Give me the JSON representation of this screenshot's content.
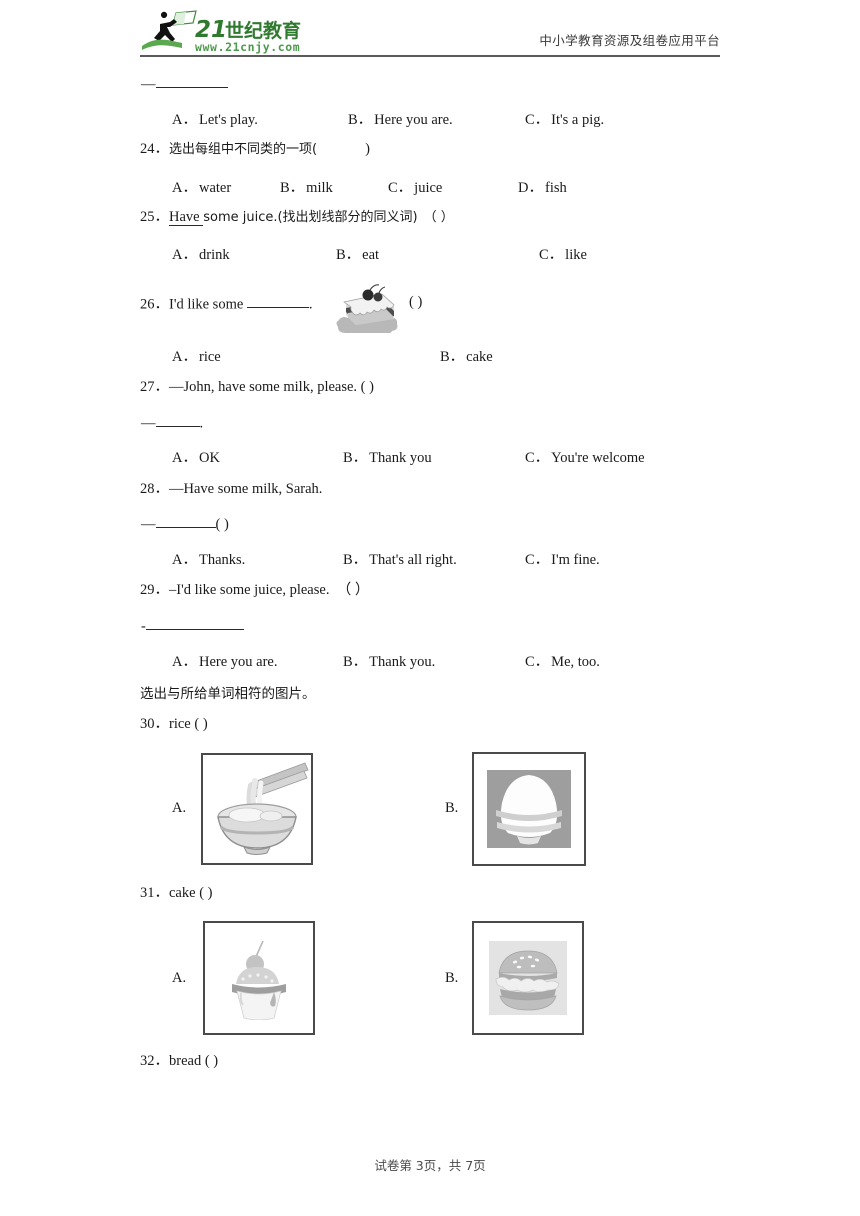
{
  "header": {
    "logo_title": "21世纪教育",
    "logo_url": "www.21cnjy.com",
    "logo_digits": "21",
    "logo_han": "世纪教育",
    "platform_text": "中小学教育资源及组卷应用平台",
    "brand_color": "#3d8b3d",
    "brand_color_dark": "#2f6b2f"
  },
  "questions": [
    {
      "id": "q23-continuation",
      "stem_dash": "—",
      "stem_blank": true,
      "options": [
        {
          "label": "A．",
          "text": "Let's play."
        },
        {
          "label": "B．",
          "text": "Here you are."
        },
        {
          "label": "C．",
          "text": "It's a pig."
        }
      ]
    },
    {
      "id": "q24",
      "number": "24．",
      "stem": "选出每组中不同类的一项(",
      "stem_tail": ")",
      "options": [
        {
          "label": "A．",
          "text": "water"
        },
        {
          "label": "B．",
          "text": "milk"
        },
        {
          "label": "C．",
          "text": "juice"
        },
        {
          "label": "D．",
          "text": "fish"
        }
      ]
    },
    {
      "id": "q25",
      "number": "25．",
      "stem_underlined": "Have",
      "stem_rest": "some juice.(找出划线部分的同义词)",
      "stem_paren": "（              ）",
      "options": [
        {
          "label": "A．",
          "text": "drink"
        },
        {
          "label": "B．",
          "text": "eat"
        },
        {
          "label": "C．",
          "text": "like"
        }
      ]
    },
    {
      "id": "q26",
      "number": "26．",
      "stem_pre": "I'd like some",
      "stem_post": ".",
      "stem_paren": "(              )",
      "image_alt": "cake-slice-illustration",
      "options": [
        {
          "label": "A．",
          "text": "rice"
        },
        {
          "label": "B．",
          "text": "cake"
        }
      ]
    },
    {
      "id": "q27",
      "number": "27．",
      "stem": "—John, have some milk, please. (              )",
      "stem_line2_dash": "—",
      "stem_line2_tail": ".",
      "options": [
        {
          "label": "A．",
          "text": "OK"
        },
        {
          "label": "B．",
          "text": "Thank you"
        },
        {
          "label": "C．",
          "text": "You're welcome"
        }
      ]
    },
    {
      "id": "q28",
      "number": "28．",
      "stem": "—Have some milk, Sarah.",
      "stem_line2_dash": "—",
      "stem_line2_tail": "(              )",
      "options": [
        {
          "label": "A．",
          "text": "Thanks."
        },
        {
          "label": "B．",
          "text": "That's all right."
        },
        {
          "label": "C．",
          "text": "I'm fine."
        }
      ]
    },
    {
      "id": "q29",
      "number": "29．",
      "stem": "–I'd like some juice, please.　（    ）",
      "stem_line2_dash": "-",
      "options": [
        {
          "label": "A．",
          "text": "Here you are."
        },
        {
          "label": "B．",
          "text": "Thank you."
        },
        {
          "label": "C．",
          "text": "Me, too."
        }
      ]
    }
  ],
  "section_heading": "选出与所给单词相符的图片。",
  "picture_questions": [
    {
      "id": "q30",
      "number": "30．",
      "word": "rice",
      "paren": "(    )",
      "options": [
        {
          "label": "A.",
          "image_alt": "noodle-bowl-with-chopsticks"
        },
        {
          "label": "B.",
          "image_alt": "bowl-of-rice"
        }
      ]
    },
    {
      "id": "q31",
      "number": "31．",
      "word": "cake",
      "paren": "(    )",
      "options": [
        {
          "label": "A.",
          "image_alt": "cupcake-with-cherry"
        },
        {
          "label": "B.",
          "image_alt": "hamburger"
        }
      ]
    },
    {
      "id": "q32",
      "number": "32．",
      "word": "bread",
      "paren": "(    )"
    }
  ],
  "footer": {
    "text": "试卷第 3页，共 7页"
  }
}
